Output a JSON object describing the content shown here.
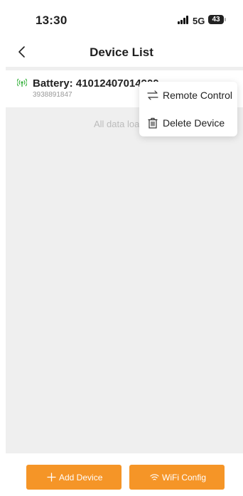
{
  "status_bar": {
    "time": "13:30",
    "network": "5G",
    "battery": "43"
  },
  "nav": {
    "title": "Device List"
  },
  "device": {
    "name": "Battery: 41012407014900",
    "serial": "3938891847"
  },
  "list_footer": "All data loa",
  "menu": {
    "items": [
      {
        "label": "Remote Control",
        "icon": "swap-arrows-icon"
      },
      {
        "label": "Delete Device",
        "icon": "trash-icon"
      }
    ]
  },
  "buttons": {
    "add_device": "Add Device",
    "wifi_config": "WiFi Config"
  },
  "colors": {
    "accent": "#f59527",
    "online": "#43b649"
  }
}
